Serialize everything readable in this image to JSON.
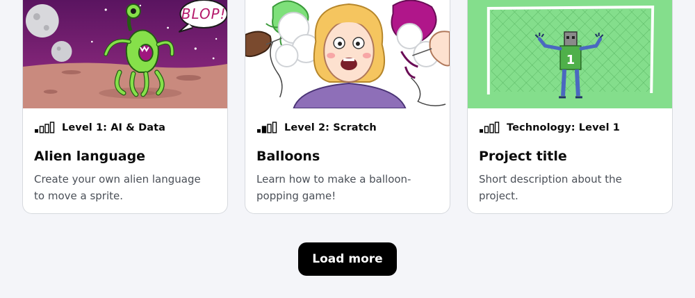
{
  "cards": [
    {
      "level_icon": "signal-bars-icon",
      "level": "Level 1: AI & Data",
      "title": "Alien language",
      "description": "Create your own alien language to move a sprite.",
      "image_speech_text": "BLOP!"
    },
    {
      "level_icon": "signal-bars-icon",
      "level": "Level 2: Scratch",
      "title": "Balloons",
      "description": "Learn how to make a balloon-popping game!"
    },
    {
      "level_icon": "signal-bars-icon",
      "level": "Technology: Level 1",
      "title": "Project title",
      "description": "Short description about the project.",
      "image_shirt_number": "1"
    }
  ],
  "load_more_label": "Load more",
  "colors": {
    "page_background": "#f4f5f9",
    "card_background": "#ffffff",
    "button_background": "#000000",
    "button_text": "#ffffff",
    "alien_green": "#86e04a",
    "alien_mouth": "#a0167f",
    "sky_purple": "#6a1a6e",
    "goal_green": "#84de8c"
  }
}
